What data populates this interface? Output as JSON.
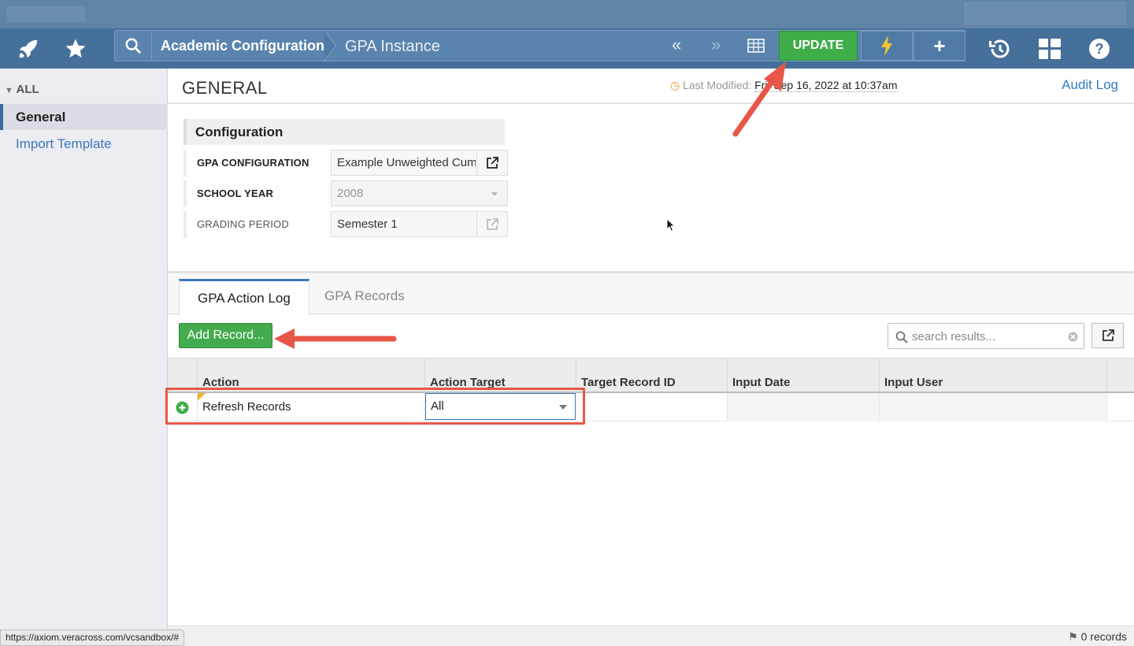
{
  "header": {
    "breadcrumb": [
      "Academic Configuration",
      "GPA Instance"
    ],
    "update_label": "UPDATE"
  },
  "sidebar": {
    "group_label": "ALL",
    "items": [
      {
        "label": "General",
        "selected": true
      },
      {
        "label": "Import Template",
        "selected": false
      }
    ]
  },
  "page": {
    "title": "GENERAL",
    "last_modified_label": "Last Modified:",
    "last_modified_value": "Fri, Sep 16, 2022 at 10:37am",
    "audit_log_label": "Audit Log"
  },
  "configuration": {
    "heading": "Configuration",
    "fields": [
      {
        "label": "GPA CONFIGURATION",
        "value": "Example Unweighted Cumulative"
      },
      {
        "label": "SCHOOL YEAR",
        "value": "2008"
      },
      {
        "label": "GRADING PERIOD",
        "value": "Semester 1"
      }
    ]
  },
  "tabs": [
    {
      "label": "GPA Action Log",
      "active": true
    },
    {
      "label": "GPA Records",
      "active": false
    }
  ],
  "toolbar": {
    "add_record_label": "Add Record...",
    "search_placeholder": "search results..."
  },
  "grid": {
    "columns": [
      "Action",
      "Action Target",
      "Target Record ID",
      "Input Date",
      "Input User"
    ],
    "rows": [
      {
        "action": "Refresh Records",
        "action_target": "All",
        "target_record_id": "",
        "input_date": "",
        "input_user": ""
      }
    ]
  },
  "footer": {
    "records_label": "0 records",
    "status_url": "https://axiom.veracross.com/vcsandbox/#"
  },
  "colors": {
    "nav_bg": "#45709a",
    "update_green": "#3fae49",
    "link_blue": "#2f7dc2",
    "annotation_red": "#e85648"
  }
}
